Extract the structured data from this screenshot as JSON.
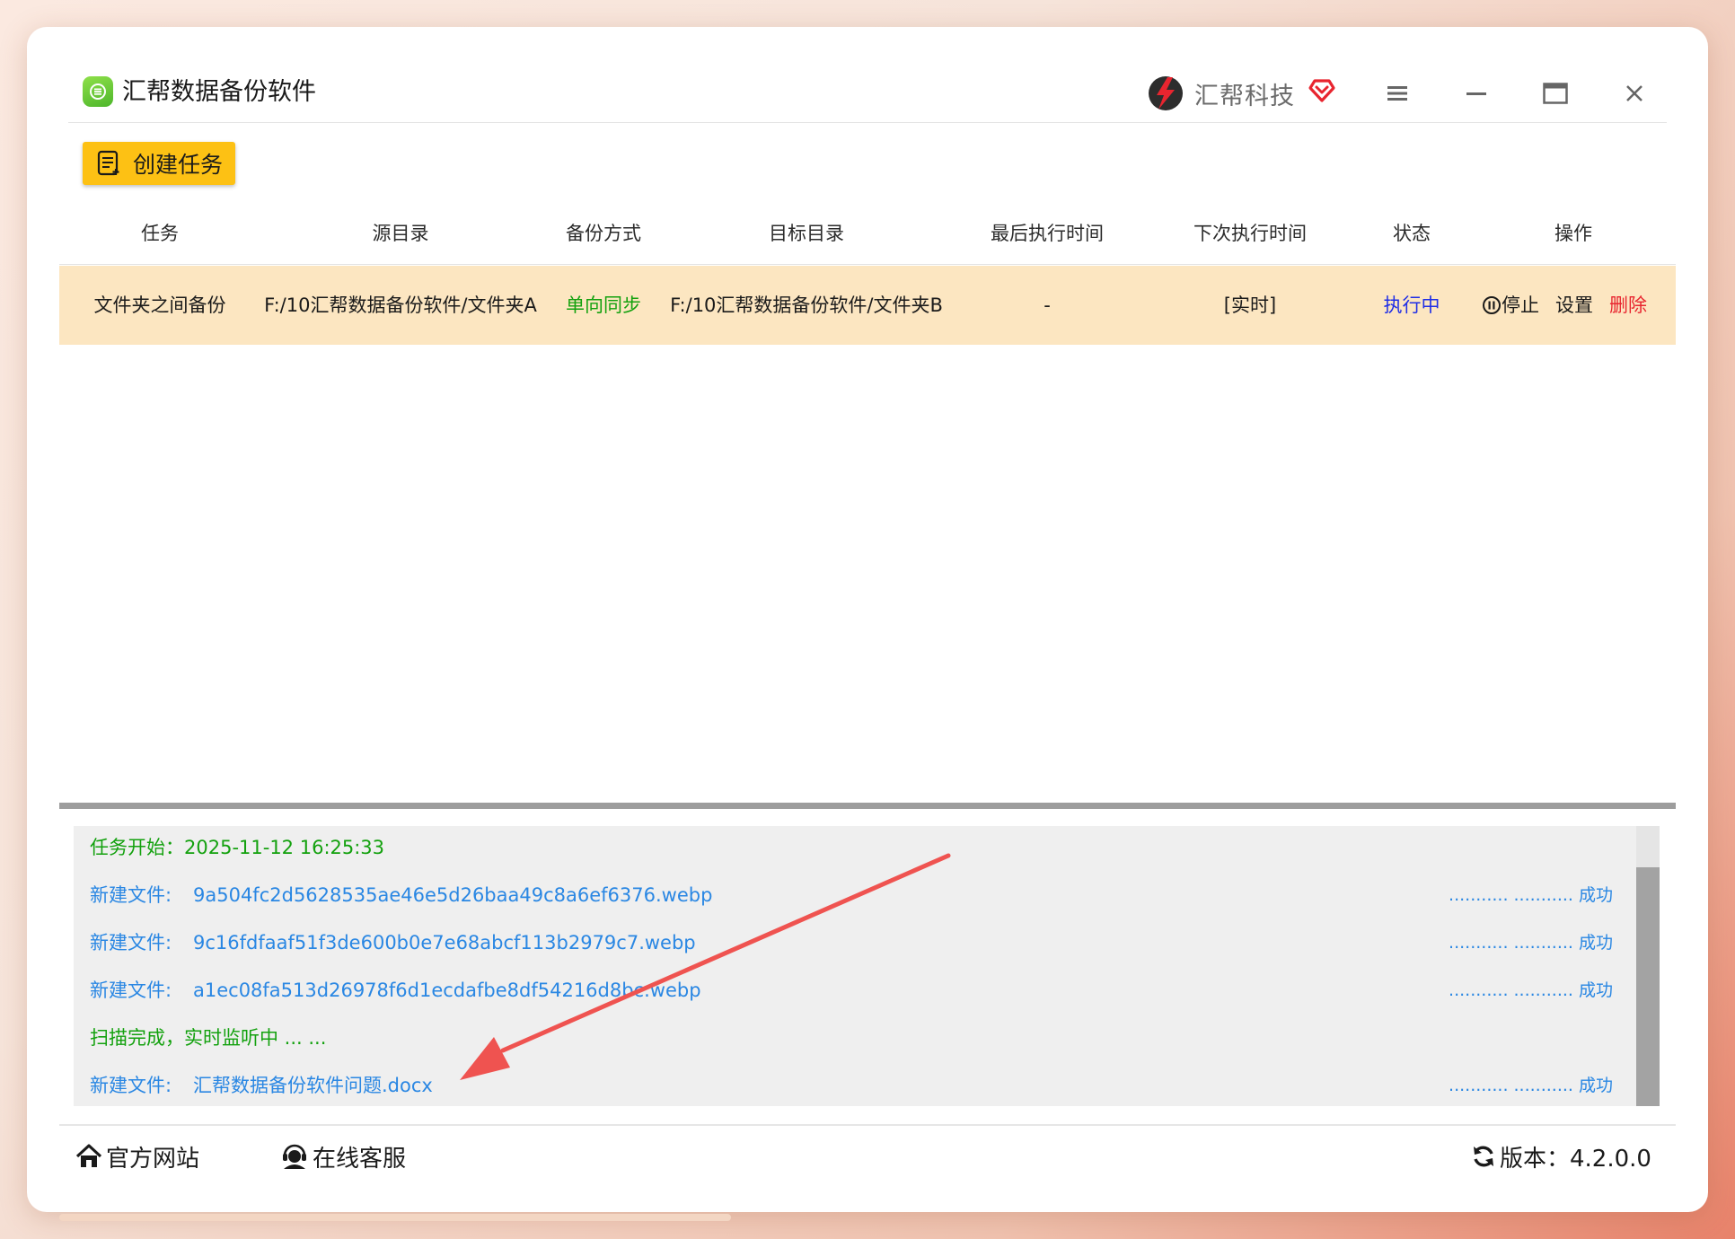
{
  "app": {
    "title": "汇帮数据备份软件",
    "brand_name": "汇帮科技"
  },
  "toolbar": {
    "create_label": "创建任务"
  },
  "table": {
    "headers": [
      "任务",
      "源目录",
      "备份方式",
      "目标目录",
      "最后执行时间",
      "下次执行时间",
      "状态",
      "操作"
    ],
    "rows": [
      {
        "task": "文件夹之间备份",
        "source": "F:/10汇帮数据备份软件/文件夹A",
        "mode": "单向同步",
        "target": "F:/10汇帮数据备份软件/文件夹B",
        "last_run": "-",
        "next_run": "[实时]",
        "status": "执行中",
        "actions": {
          "stop": "停止",
          "settings": "设置",
          "delete": "删除"
        }
      }
    ]
  },
  "log": {
    "entries": [
      {
        "text": "任务开始：2025-11-12 16:25:33",
        "color": "#13a10e"
      },
      {
        "label": "新建文件:",
        "file": "9a504fc2d5628535ae46e5d26baa49c8a6ef6376.webp",
        "result": "........... ........... 成功",
        "color": "#2a87e3"
      },
      {
        "label": "新建文件:",
        "file": "9c16fdfaaf51f3de600b0e7e68abcf113b2979c7.webp",
        "result": "........... ........... 成功",
        "color": "#2a87e3"
      },
      {
        "label": "新建文件:",
        "file": "a1ec08fa513d26978f6d1ecdafbe8df54216d8bc.webp",
        "result": "........... ........... 成功",
        "color": "#2a87e3"
      },
      {
        "text": "扫描完成，实时监听中 ... ...",
        "color": "#13a10e"
      },
      {
        "label": "新建文件:",
        "file": "汇帮数据备份软件问题.docx",
        "result": "........... ........... 成功",
        "color": "#2a87e3"
      }
    ]
  },
  "footer": {
    "website": "官方网站",
    "support": "在线客服",
    "version": "版本：4.2.0.0"
  },
  "colors": {
    "accent_yellow": "#fdc114",
    "row_highlight": "#fce6c1",
    "status_blue": "#1f2ee6",
    "mode_green": "#13a10e",
    "delete_red": "#e8252f",
    "log_blue": "#2a87e3",
    "annotation_arrow": "#ef5350"
  }
}
